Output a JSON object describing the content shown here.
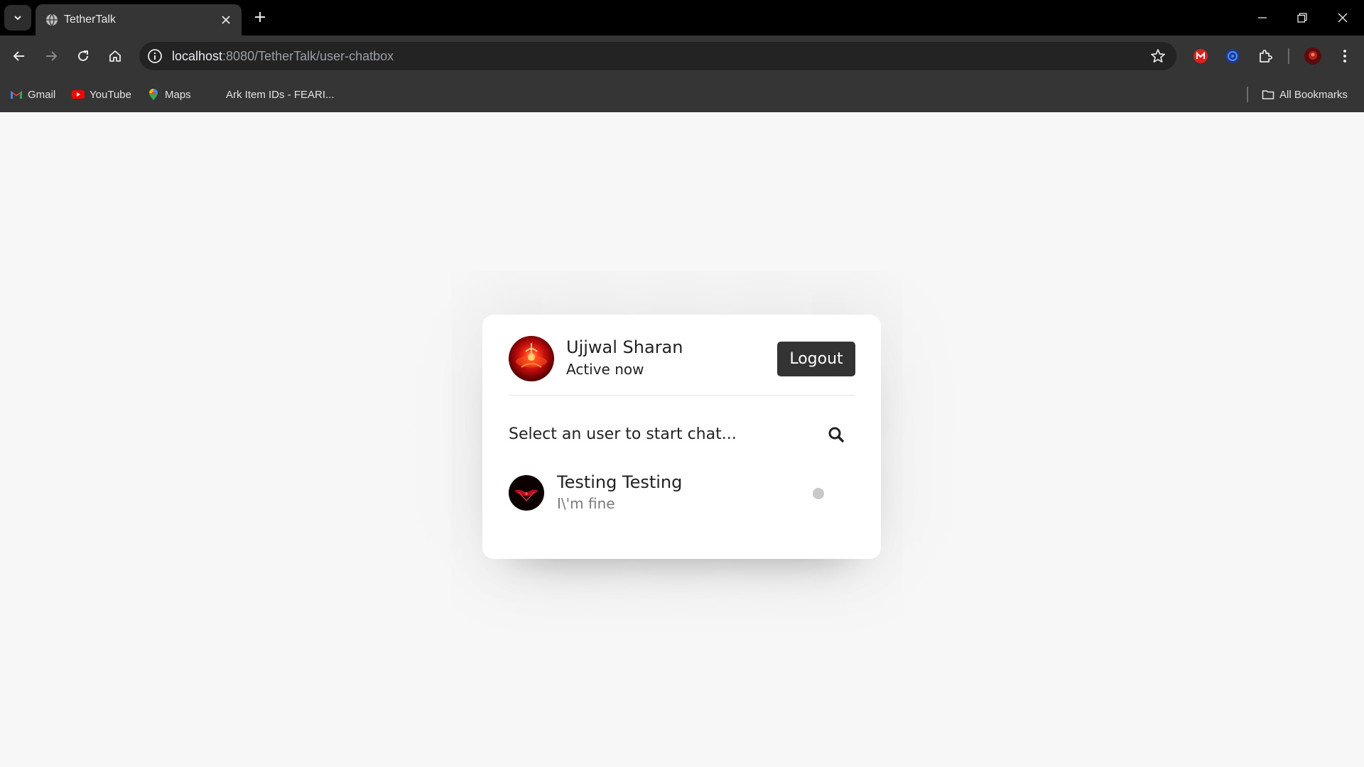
{
  "browser": {
    "tab_title": "TetherTalk",
    "url_host": "localhost",
    "url_rest": ":8080/TetherTalk/user-chatbox",
    "bookmarks": [
      {
        "label": "Gmail",
        "icon": "gmail-icon"
      },
      {
        "label": "YouTube",
        "icon": "youtube-icon"
      },
      {
        "label": "Maps",
        "icon": "maps-icon"
      },
      {
        "label": "Ark Item IDs - FEARI...",
        "icon": "none"
      }
    ],
    "all_bookmarks_label": "All Bookmarks"
  },
  "chat": {
    "current_user": {
      "name": "Ujjwal Sharan",
      "status": "Active now"
    },
    "logout_label": "Logout",
    "search_prompt": "Select an user to start chat...",
    "users": [
      {
        "name": "Testing Testing",
        "last_message": "I\\'m fine",
        "online": false
      }
    ]
  },
  "colors": {
    "accent_dark": "#333333",
    "offline_dot": "#c8c8c8",
    "page_background": "#f7f7f7"
  }
}
